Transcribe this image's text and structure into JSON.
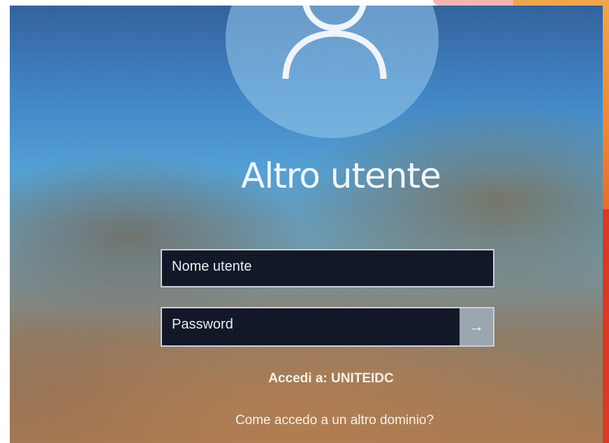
{
  "lock_screen": {
    "title": "Altro utente",
    "username_field": {
      "placeholder": "Nome utente",
      "value": ""
    },
    "password_field": {
      "placeholder": "Password",
      "value": ""
    },
    "submit_icon": "arrow-right-icon",
    "signin_domain_text": "Accedi a: UNITEIDC",
    "other_domain_link": "Come accedo a un altro dominio?",
    "avatar_icon": "user-icon"
  },
  "colors": {
    "text": "#f2f6fb",
    "field_background": "#0d1322",
    "field_border": "#c9ced4",
    "submit_button": "#9aa4ad",
    "slide_orange": "#ec8a3a",
    "slide_red": "#d83a25"
  }
}
